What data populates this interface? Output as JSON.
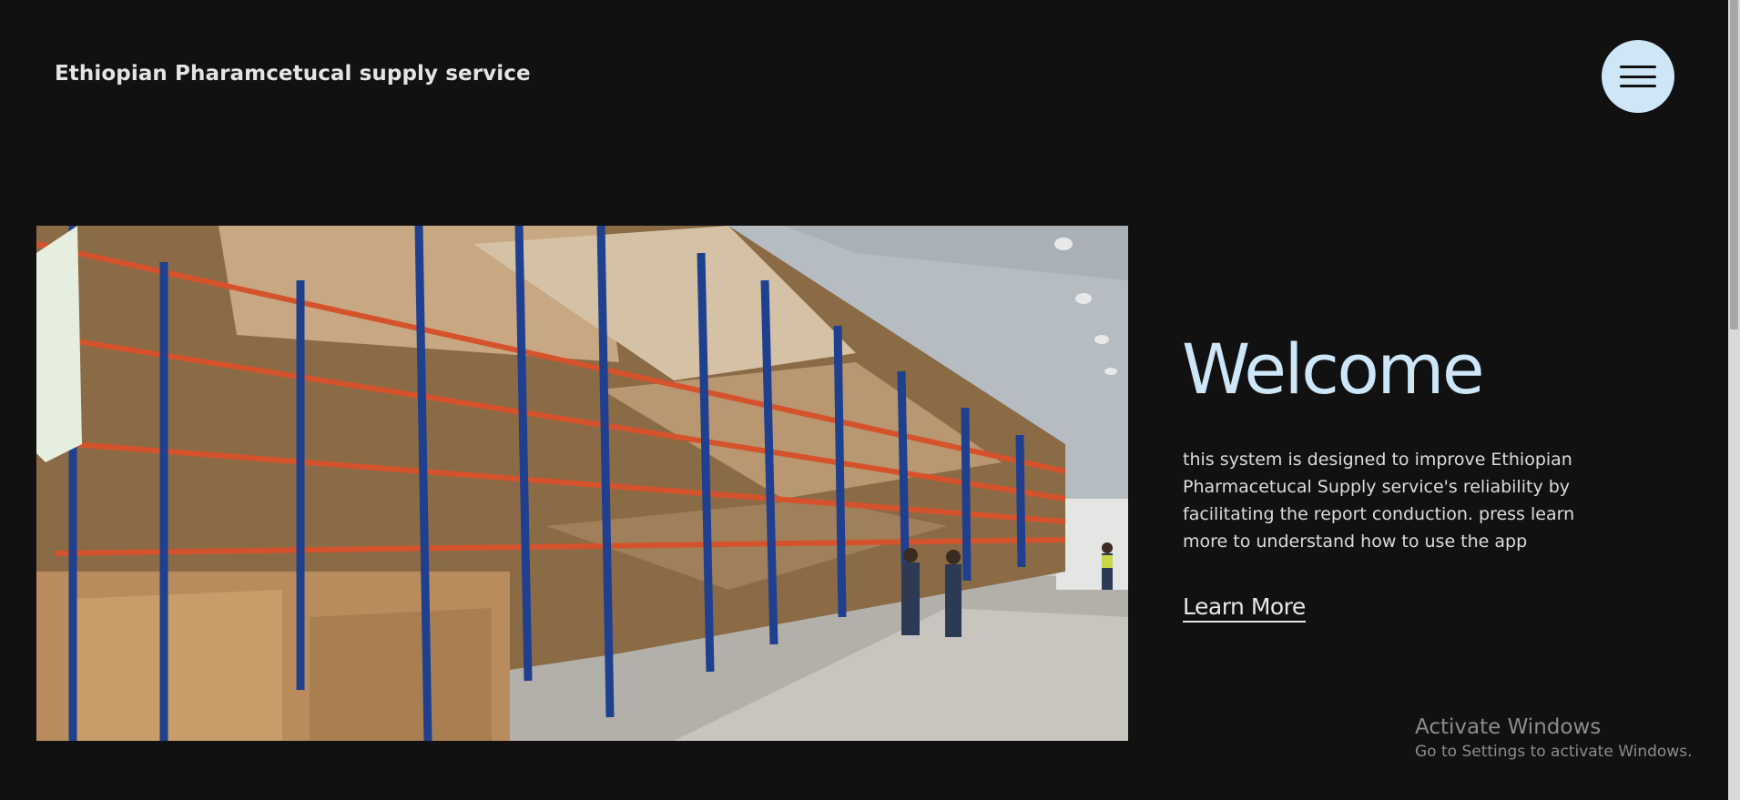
{
  "header": {
    "brand": "Ethiopian Pharamcetucal supply service",
    "menu_icon": "hamburger-menu-icon"
  },
  "hero": {
    "image_alt": "warehouse-shelves-image",
    "title": "Welcome",
    "description": "this system is designed to improve Ethiopian Pharmacetucal Supply service's reliability by facilitating the report conduction. press learn more to understand how to use the app",
    "cta_label": "Learn More"
  },
  "watermark": {
    "title": "Activate Windows",
    "subtitle": "Go to Settings to activate Windows."
  },
  "colors": {
    "background": "#111111",
    "accent": "#cde6f8",
    "menu_button": "#cfe6f7"
  }
}
